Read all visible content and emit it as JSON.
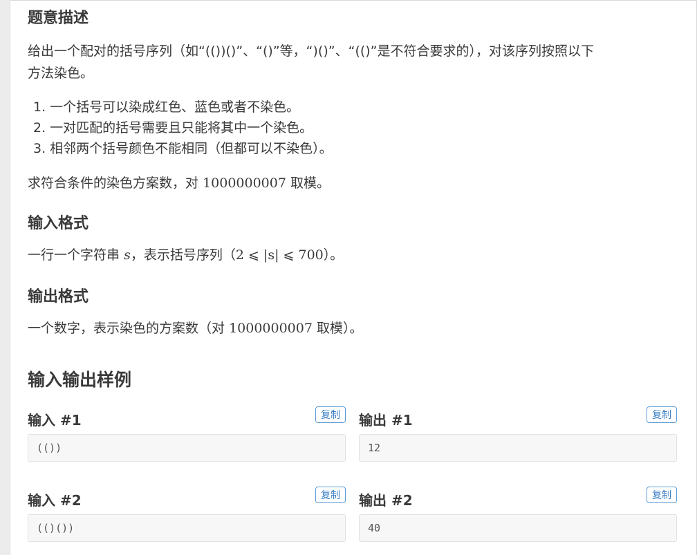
{
  "problem": {
    "heading_description": "题意描述",
    "description_line1": "给出一个配对的括号序列（如“(())()”、“()”等，“)()”、“(()”是不符合要求的），对该序列按照以下",
    "description_line2": "方法染色。",
    "rules": [
      "1. 一个括号可以染成红色、蓝色或者不染色。",
      "2. 一对匹配的括号需要且只能将其中一个染色。",
      "3. 相邻两个括号颜色不能相同（但都可以不染色）。"
    ],
    "task_prefix": "求符合条件的染色方案数，对",
    "task_modulus": "1000000007",
    "task_suffix": "取模。",
    "heading_input": "输入格式",
    "input_prefix": "一行一个字符串",
    "input_var": "s",
    "input_middle": "，表示括号序列（",
    "input_constraint": "2 ⩽ |s| ⩽ 700",
    "input_suffix": "）。",
    "heading_output": "输出格式",
    "output_prefix": "一个数字，表示染色的方案数（对",
    "output_modulus": "1000000007",
    "output_suffix": "取模）。",
    "heading_samples": "输入输出样例"
  },
  "samples": [
    {
      "input_title": "输入 #1",
      "input_value": "(())",
      "output_title": "输出 #1",
      "output_value": "12"
    },
    {
      "input_title": "输入 #2",
      "input_value": "(()())",
      "output_title": "输出 #2",
      "output_value": "40"
    }
  ],
  "copy_label": "复制"
}
